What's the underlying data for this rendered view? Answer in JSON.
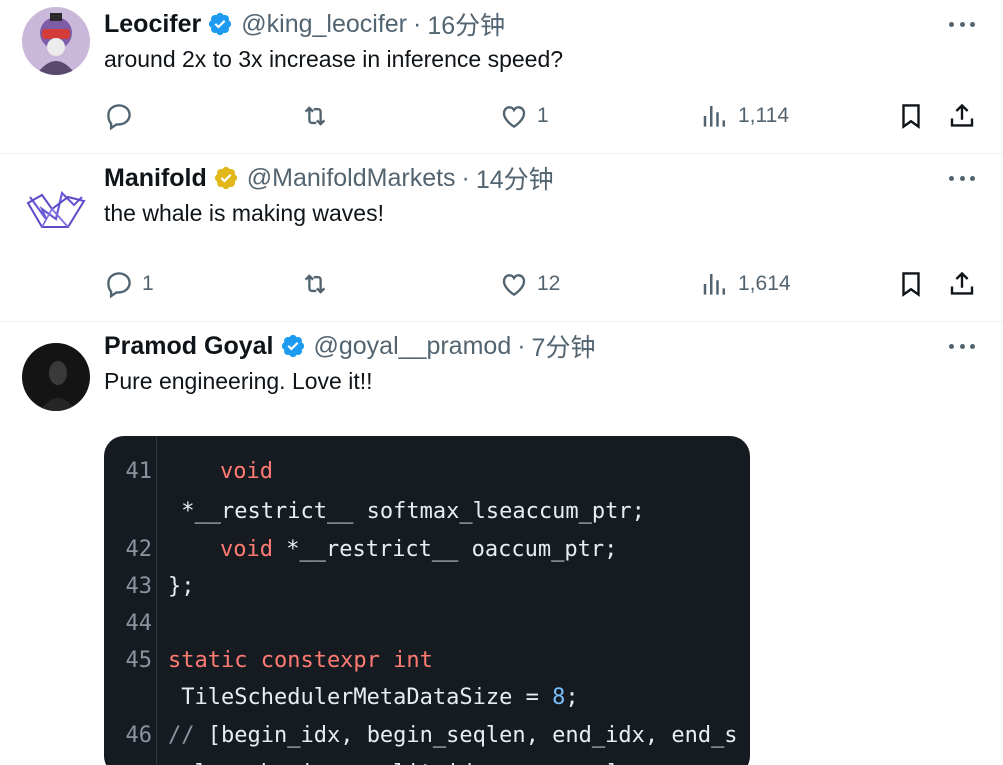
{
  "tweets": [
    {
      "name": "Leocifer",
      "handle": "@king_leocifer",
      "dot": "·",
      "time": "16分钟",
      "text": "around 2x to 3x increase in inference speed?",
      "verified": "blue",
      "replies": "",
      "retweets": "",
      "likes": "1",
      "views": "1,114"
    },
    {
      "name": "Manifold",
      "handle": "@ManifoldMarkets",
      "dot": "·",
      "time": "14分钟",
      "text": "the whale is making waves!",
      "verified": "gold",
      "replies": "1",
      "retweets": "",
      "likes": "12",
      "views": "1,614"
    },
    {
      "name": "Pramod Goyal",
      "handle": "@goyal__pramod",
      "dot": "·",
      "time": "7分钟",
      "text": "Pure engineering. Love it!!",
      "verified": "blue"
    }
  ],
  "code": {
    "lines": [
      {
        "num": "41",
        "parts": [
          "",
          "void",
          ""
        ]
      },
      {
        "num": "",
        "parts": [
          " *__restrict__ softmax_lseaccum_ptr;"
        ]
      },
      {
        "num": "42",
        "parts": [
          "   ",
          "void",
          " *__restrict__ oaccum_ptr;"
        ]
      },
      {
        "num": "43",
        "parts": [
          "};"
        ]
      },
      {
        "num": "44",
        "parts": [
          ""
        ]
      },
      {
        "num": "45",
        "parts": [
          "static constexpr int"
        ]
      },
      {
        "num": "",
        "parts": [
          " TileSchedulerMetaDataSize = ",
          "8",
          ";"
        ]
      },
      {
        "num": "46",
        "parts": [
          "// [begin_idx, begin_seqlen, end_idx, end_s"
        ]
      },
      {
        "num": "",
        "parts": [
          "eqlen, begin_n_split_idx, _, _, _]"
        ]
      }
    ]
  },
  "colors": {
    "accent_blue": "#1d9bf0",
    "verified_gold": "#e2b719",
    "muted_text": "#536471",
    "code_bg": "#161b22",
    "code_keyword": "#ff7b72",
    "code_number": "#79c0ff",
    "code_comment": "#8b949e"
  },
  "icons": [
    "more-icon",
    "reply-icon",
    "retweet-icon",
    "like-icon",
    "views-icon",
    "bookmark-icon",
    "share-icon",
    "verified-badge-icon"
  ]
}
